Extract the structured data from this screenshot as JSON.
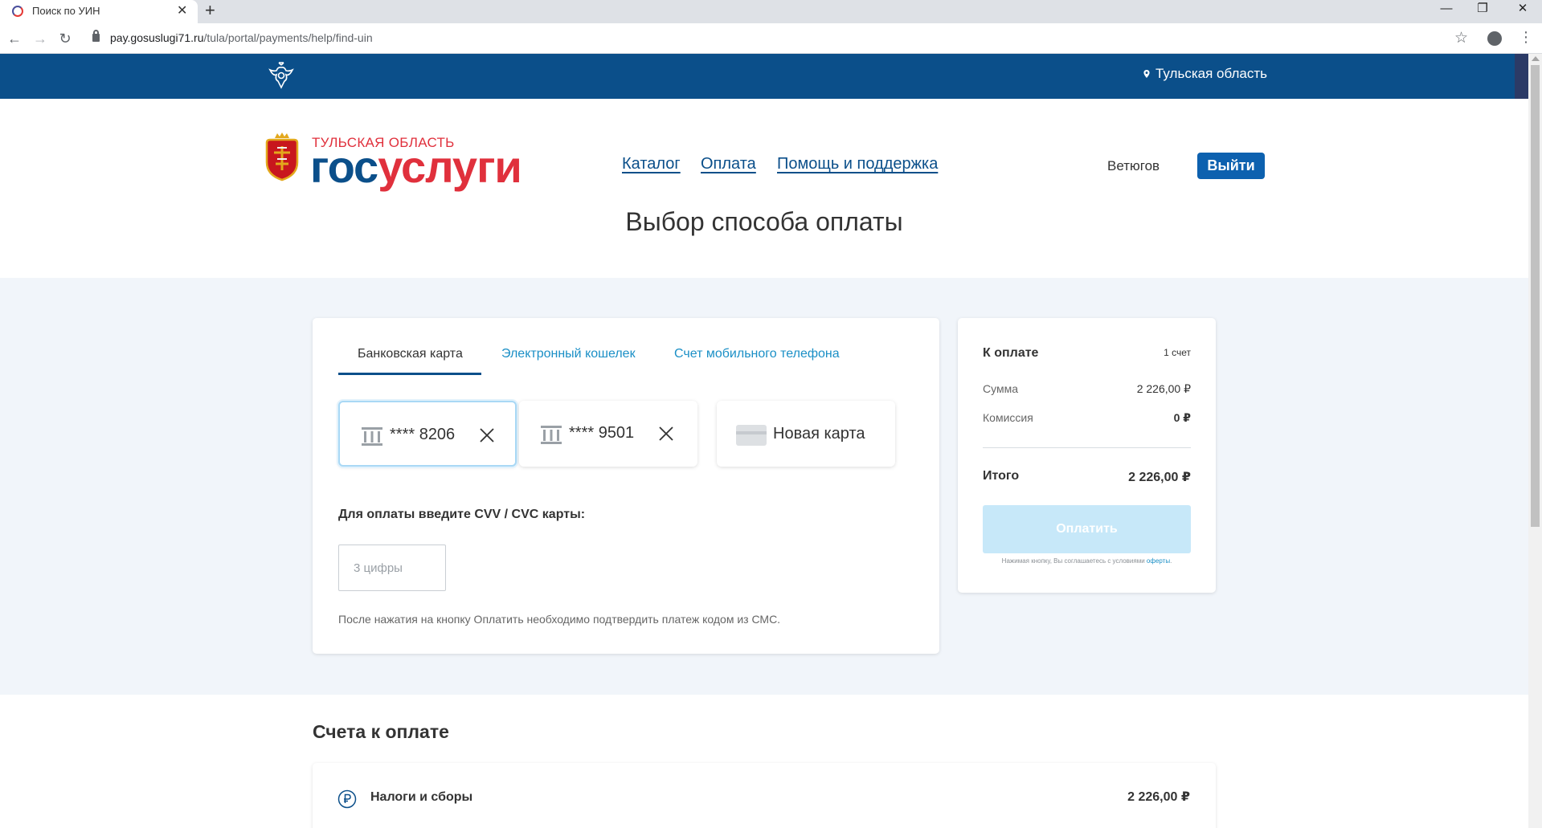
{
  "browser": {
    "tab_title": "Поиск по УИН",
    "tab_close": "✕",
    "new_tab": "+",
    "url_host": "pay.gosuslugi71.ru",
    "url_path": "/tula/portal/payments/help/find-uin",
    "win_minimize": "—",
    "win_restore": "❐",
    "win_close": "✕"
  },
  "header": {
    "region": "Тульская область",
    "logo_subtitle": "ТУЛЬСКАЯ ОБЛАСТЬ",
    "logo_gos": "гос",
    "logo_uslugi": "услуги",
    "nav": [
      "Каталог",
      "Оплата",
      "Помощь и поддержка"
    ],
    "user_name": "Ветюгов",
    "logout_label": "Выйти"
  },
  "page": {
    "title": "Выбор способа оплаты"
  },
  "payment": {
    "tabs": [
      "Банковская карта",
      "Электронный кошелек",
      "Счет мобильного телефона"
    ],
    "active_tab": 0,
    "saved_cards": [
      "**** 8206",
      "**** 9501"
    ],
    "new_card_label": "Новая карта",
    "cvv_label": "Для оплаты введите CVV / CVC карты:",
    "cvv_placeholder": "3 цифры",
    "sms_note": "После нажатия на кнопку Оплатить необходимо подтвердить платеж кодом из СМС."
  },
  "summary": {
    "title": "К оплате",
    "count": "1 счет",
    "sum_label": "Сумма",
    "sum_value": "2 226,00 ₽",
    "fee_label": "Комиссия",
    "fee_value": "0 ₽",
    "total_label": "Итого",
    "total_value": "2 226,00 ₽",
    "pay_button": "Оплатить",
    "agree_prefix": "Нажимая кнопку, Вы соглашаетесь с условиями ",
    "agree_link": "оферты",
    "agree_suffix": "."
  },
  "invoices": {
    "heading": "Счета к оплате",
    "items": [
      {
        "name": "Налоги и сборы",
        "amount": "2 226,00 ₽"
      }
    ]
  },
  "colors": {
    "brand_blue": "#0b4f8a",
    "brand_red": "#e0303c",
    "link_blue": "#1a8fc6",
    "button_blue": "#0d61af",
    "pay_button_disabled": "#c7e8f9",
    "band_bg": "#f1f5fa"
  },
  "icons": {
    "emblem": "russian-eagle-icon",
    "region_pin": "location-pin-icon",
    "coat_of_arms": "tula-coat-of-arms-icon",
    "saved_card": "bank-icon",
    "remove_card": "close-icon",
    "new_card": "credit-card-icon",
    "invoice_type": "ruble-icon"
  }
}
